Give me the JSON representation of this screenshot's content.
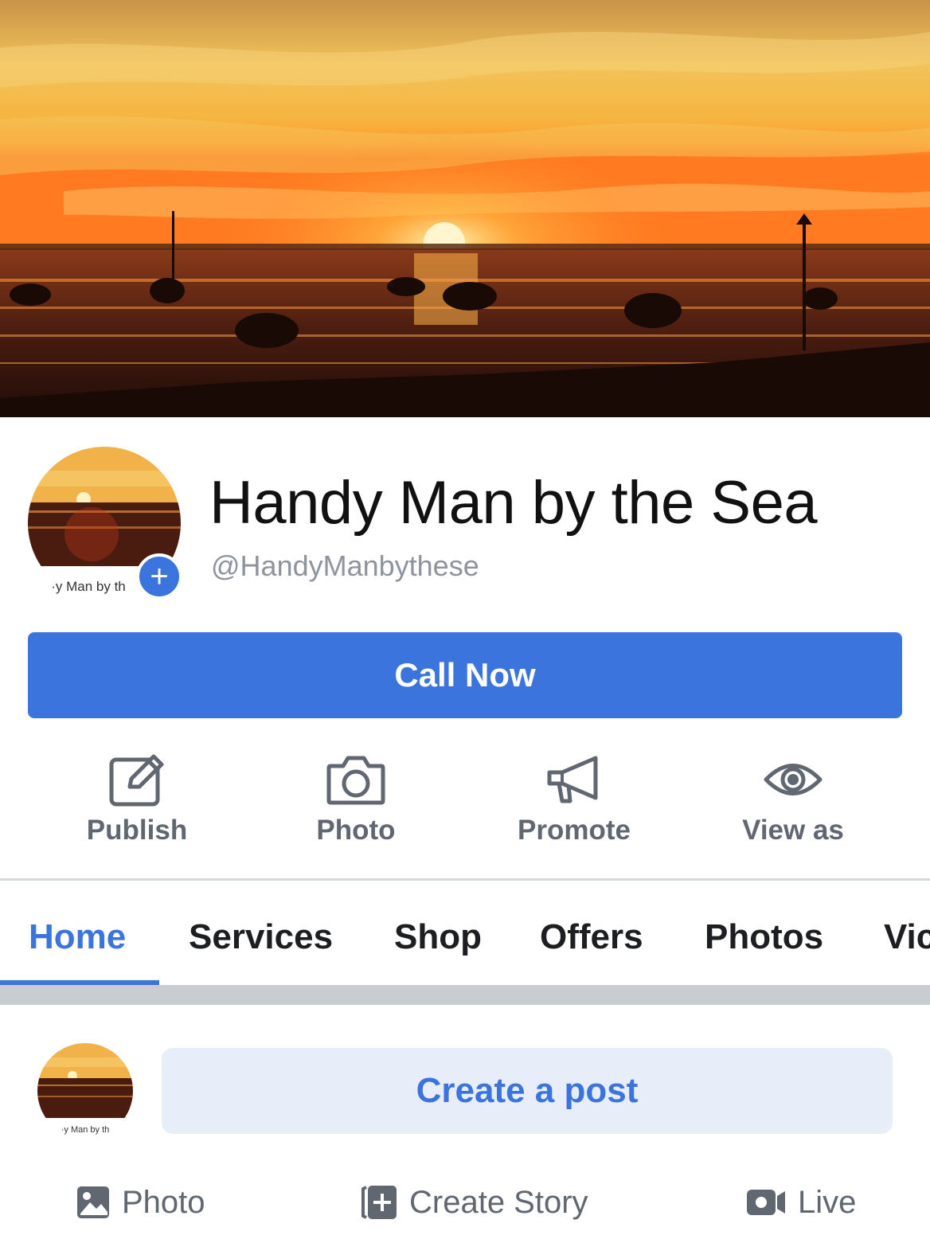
{
  "cover": {
    "description_colors": {
      "sky_top": "#e8a64a",
      "sky_mid": "#f4b640",
      "horizon": "#ff8a2a",
      "water": "#3a1a10"
    }
  },
  "profile": {
    "name": "Handy Man by the Sea",
    "handle": "@HandyManbythese",
    "avatar_caption": "·y Man by th",
    "add_icon": "plus-icon"
  },
  "cta": {
    "label": "Call Now",
    "color": "#3a74dc"
  },
  "actions": [
    {
      "label": "Publish",
      "icon": "edit-icon"
    },
    {
      "label": "Photo",
      "icon": "camera-icon"
    },
    {
      "label": "Promote",
      "icon": "megaphone-icon"
    },
    {
      "label": "View as",
      "icon": "eye-icon"
    }
  ],
  "tabs": [
    {
      "label": "Home",
      "active": true
    },
    {
      "label": "Services",
      "active": false
    },
    {
      "label": "Shop",
      "active": false
    },
    {
      "label": "Offers",
      "active": false
    },
    {
      "label": "Photos",
      "active": false
    },
    {
      "label": "Vic",
      "active": false
    }
  ],
  "composer": {
    "avatar_caption": "·y Man by th",
    "create_post_label": "Create a post",
    "buttons": [
      {
        "label": "Photo",
        "icon": "image-icon"
      },
      {
        "label": "Create Story",
        "icon": "story-plus-icon"
      },
      {
        "label": "Live",
        "icon": "video-icon"
      }
    ]
  },
  "colors": {
    "accent": "#3a74dc",
    "muted": "#606770",
    "handle": "#8d949e",
    "light_accent_bg": "#e7eefa"
  }
}
